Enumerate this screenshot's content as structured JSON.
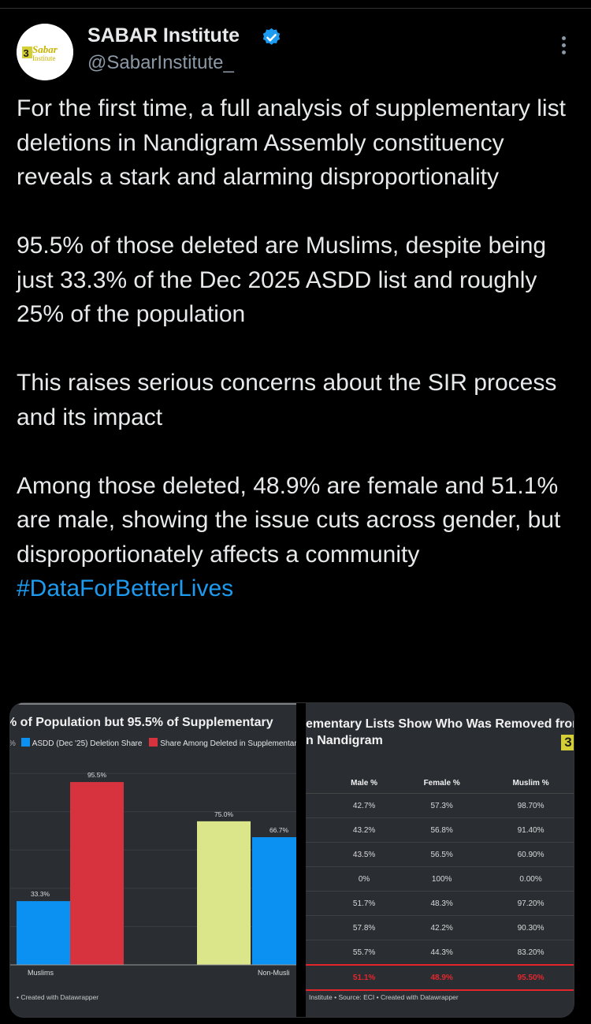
{
  "author": {
    "name": "SABAR Institute",
    "handle": "@SabarInstitute_",
    "avatar_text": "Sabar Institute"
  },
  "tweet": {
    "paragraph1": "For the first time, a full analysis of supplementary list deletions in Nandigram Assembly constituency reveals a stark and alarming disproportionality",
    "paragraph2": "95.5% of those deleted are Muslims, despite being just 33.3% of the Dec 2025 ASDD list and roughly 25% of the population",
    "paragraph3": "This raises serious concerns about the SIR process and its impact",
    "paragraph4": "Among those deleted, 48.9% are female and 51.1% are male, showing the issue cuts across gender, but disproportionately affects a community",
    "hashtag": "#DataForBetterLives"
  },
  "colors": {
    "accent": "#1d9bf0",
    "series_blue": "#0a91f2",
    "series_red": "#d7333f",
    "series_yellow": "#dbe58a",
    "highlight_red": "#e3262c"
  },
  "chart_data": [
    {
      "type": "bar",
      "title": "% of Population but 95.5% of Supplementary",
      "legend": [
        "ASDD (Dec '25) Deletion Share",
        "Share Among Deleted in Supplementary"
      ],
      "categories": [
        "Muslims",
        "Non-Musli"
      ],
      "bars": [
        {
          "category": "Muslims",
          "value": 33.3,
          "label": "33.3%",
          "color": "#0a91f2"
        },
        {
          "category": "Muslims",
          "value": 95.5,
          "label": "95.5%",
          "color": "#d7333f"
        },
        {
          "category": "Non-Musli",
          "value": 75.0,
          "label": "75.0%",
          "color": "#dbe58a"
        },
        {
          "category": "Non-Musli",
          "value": 66.7,
          "label": "66.7%",
          "color": "#0a91f2"
        }
      ],
      "ylim": [
        0,
        100
      ],
      "footnote": "• Created with Datawrapper"
    },
    {
      "type": "table",
      "title": "ementary Lists Show Who Was Removed from n Nandigram",
      "columns": [
        "Male %",
        "Female %",
        "Muslim %"
      ],
      "rows": [
        [
          "42.7%",
          "57.3%",
          "98.70%"
        ],
        [
          "43.2%",
          "56.8%",
          "91.40%"
        ],
        [
          "43.5%",
          "56.5%",
          "60.90%"
        ],
        [
          "0%",
          "100%",
          "0.00%"
        ],
        [
          "51.7%",
          "48.3%",
          "97.20%"
        ],
        [
          "57.8%",
          "42.2%",
          "90.30%"
        ],
        [
          "55.7%",
          "44.3%",
          "83.20%"
        ]
      ],
      "highlight_row": [
        "51.1%",
        "48.9%",
        "95.50%"
      ],
      "logo_text": "3",
      "footnote": "Institute • Source: ECI • Created with Datawrapper"
    }
  ]
}
